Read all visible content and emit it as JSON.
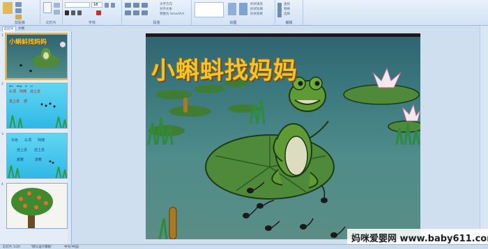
{
  "ribbon": {
    "groups": [
      "剪贴板",
      "幻灯片",
      "字体",
      "段落",
      "绘图",
      "编辑"
    ],
    "font_size": "18",
    "items": [
      "文字方向",
      "对齐文本",
      "转换为 SmartArt",
      "形状填充",
      "形状轮廓",
      "形状效果",
      "查找",
      "替换",
      "选择"
    ]
  },
  "panel": {
    "tabs": [
      "幻灯片",
      "大纲"
    ],
    "slide_numbers": [
      "1",
      "2",
      "3",
      "4"
    ],
    "slide1_title": "小蝌蚪找妈妈",
    "slide2_text": [
      [
        "tóu",
        "dǐng",
        "ā",
        "yí"
      ],
      [
        "头顶",
        "阿姨",
        "迎上去"
      ],
      [
        "追上去",
        "游"
      ]
    ],
    "slide3_text": [
      "灰色",
      "头顶",
      "阿姨",
      "迎上去",
      "迎上去",
      "披着",
      "游着"
    ]
  },
  "slide": {
    "title": "小蝌蚪找妈妈"
  },
  "status": {
    "slide_info": "幻灯片 1/20",
    "theme": "\"默认设计模板\"",
    "language": "中文(中国)"
  },
  "watermark": "妈咪爱婴网 www.baby611.com",
  "colors": {
    "title": "#f3c52d",
    "lily_pad": "#4e8a3a",
    "frog": "#5f9a35",
    "water": "#3d7a80"
  }
}
